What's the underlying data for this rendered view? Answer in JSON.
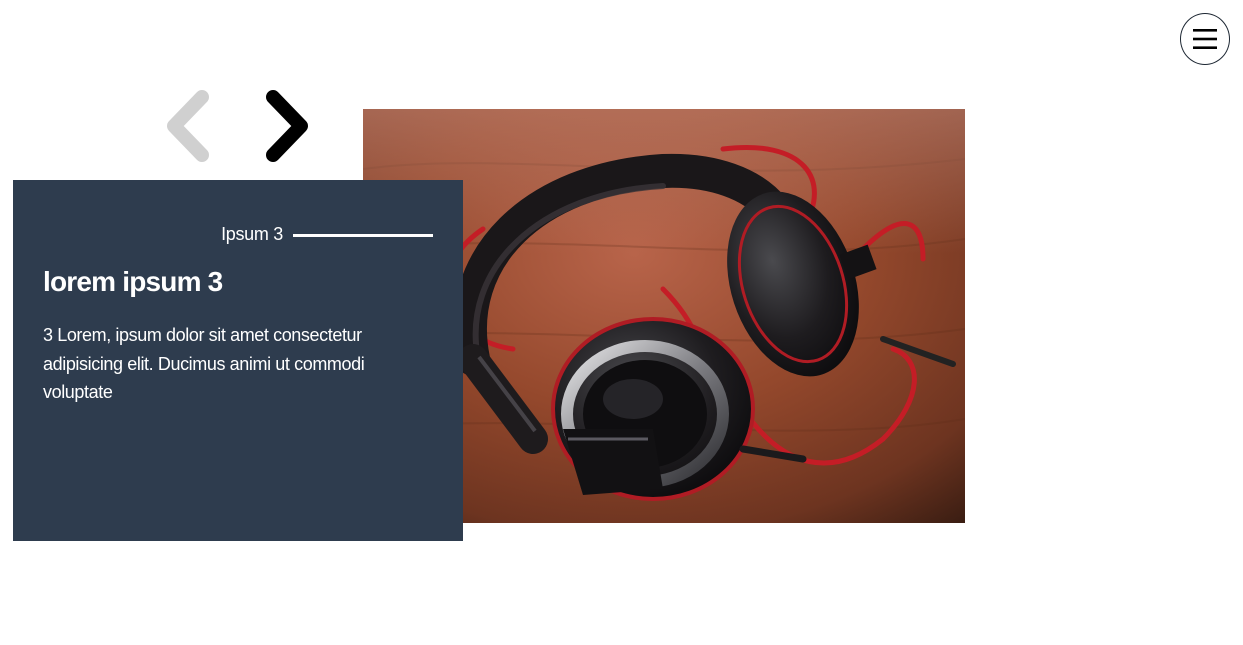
{
  "menu": {
    "icon": "hamburger-icon",
    "border_color": "#1d2733"
  },
  "slider": {
    "prev_icon": "chevron-left-icon",
    "next_icon": "chevron-right-icon",
    "prev_color": "#d0d0d0",
    "next_color": "#000000"
  },
  "slide": {
    "image": "headphones-photo",
    "tag": "Ipsum 3",
    "title": "lorem ipsum 3",
    "text": "3 Lorem, ipsum dolor sit amet consectetur adipisicing elit. Ducimus animi ut commodi voluptate"
  },
  "colors": {
    "card_background": "#2e3c4e",
    "card_text": "#ffffff",
    "page_background": "#ffffff"
  }
}
